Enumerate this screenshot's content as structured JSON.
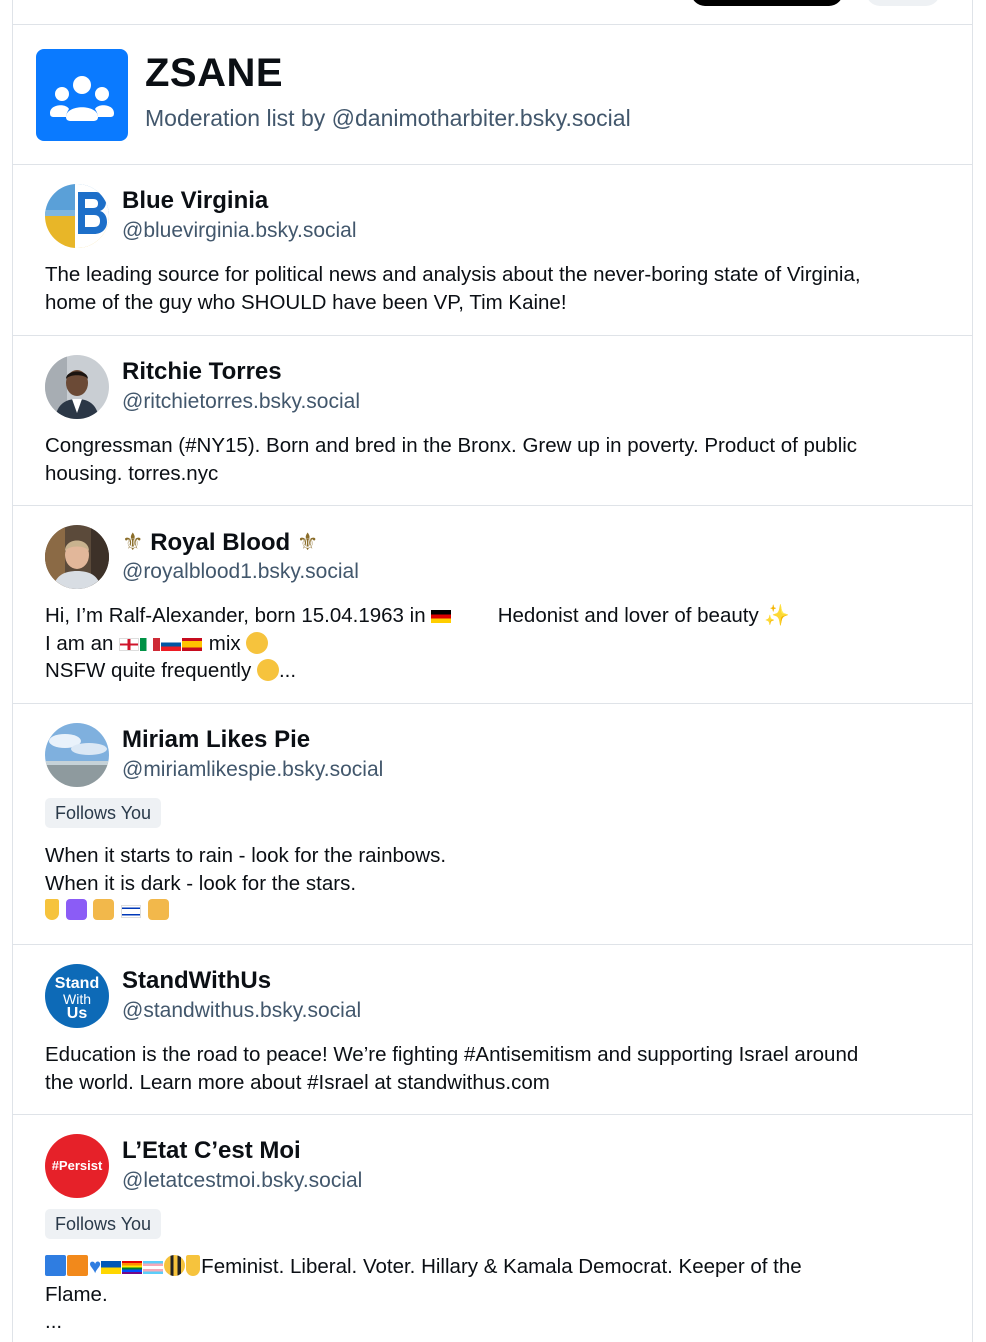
{
  "list": {
    "title": "ZSANE",
    "subtitle": "Moderation list by @danimotharbiter.bsky.social",
    "avatar_icon": "people-group-icon",
    "accent": "#0a7aff"
  },
  "profiles": [
    {
      "name": "Blue Virginia",
      "handle": "@bluevirginia.bsky.social",
      "bio_lines": [
        "The leading source for political news and analysis about the never-boring state of Virginia,",
        "home of the guy who SHOULD have been VP, Tim Kaine!"
      ]
    },
    {
      "name": "Ritchie Torres",
      "handle": "@ritchietorres.bsky.social",
      "bio_lines": [
        "Congressman (#NY15). Born and bred in the Bronx. Grew up in poverty. Product of public",
        "housing. torres.nyc"
      ]
    },
    {
      "name_prefix": "⚜",
      "name": "Royal Blood",
      "name_suffix": "⚜",
      "handle": "@royalblood1.bsky.social",
      "bio_line1_a": "Hi, I’m Ralf-Alexander, born 15.04.1963 in",
      "bio_line1_b": "Hedonist and lover of beauty",
      "bio_line2_a": "I am an",
      "bio_line2_b": "mix",
      "bio_line3": "NSFW quite frequently",
      "bio_ellipsis": "..."
    },
    {
      "name": "Miriam Likes Pie",
      "handle": "@miriamlikespie.bsky.social",
      "badge": "Follows You",
      "bio_lines": [
        "When it starts to rain - look for the rainbows.",
        "When it is dark - look for the stars."
      ]
    },
    {
      "name": "StandWithUs",
      "handle": "@standwithus.bsky.social",
      "avatar_text": [
        "Stand",
        "With",
        "Us"
      ],
      "bio_lines": [
        "Education is the road to peace! We’re fighting #Antisemitism and supporting Israel around",
        "the world. Learn more about #Israel at standwithus.com"
      ]
    },
    {
      "name": "L’Etat C’est Moi",
      "handle": "@letatcestmoi.bsky.social",
      "avatar_text": "#Persist",
      "badge": "Follows You",
      "bio_line1": "Feminist. Liberal. Voter. Hillary & Kamala Democrat. Keeper of the",
      "bio_line2": "Flame.",
      "bio_line3": "..."
    }
  ]
}
